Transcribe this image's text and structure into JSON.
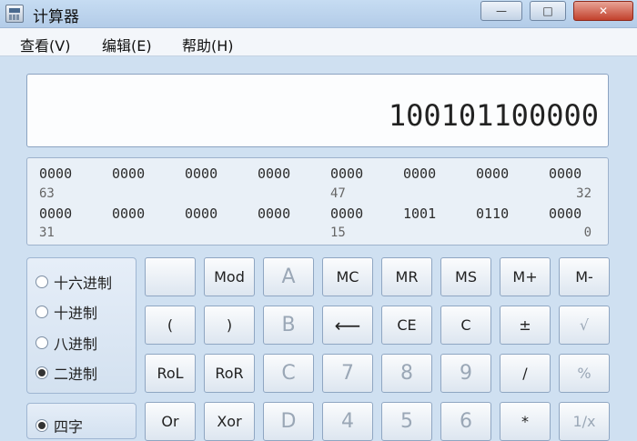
{
  "window": {
    "title": "计算器",
    "controls": {
      "minimize": "—",
      "maximize": "□",
      "close": "✕"
    }
  },
  "menu": [
    "查看(V)",
    "编辑(E)",
    "帮助(H)"
  ],
  "display": {
    "value": "100101100000"
  },
  "binary_view": {
    "row1": {
      "groups": [
        "0000",
        "0000",
        "0000",
        "0000",
        "0000",
        "0000",
        "0000",
        "0000"
      ],
      "indices": [
        "63",
        "47",
        "32"
      ]
    },
    "row2": {
      "groups": [
        "0000",
        "0000",
        "0000",
        "0000",
        "0000",
        "1001",
        "0110",
        "0000"
      ],
      "indices": [
        "31",
        "15",
        "0"
      ]
    }
  },
  "radix": {
    "options": [
      "十六进制",
      "十进制",
      "八进制",
      "二进制"
    ],
    "selected": "二进制"
  },
  "word_size": {
    "options": [
      "四字"
    ],
    "selected": "四字"
  },
  "keys": {
    "blank": "",
    "mod": "Mod",
    "A": "A",
    "mc": "MC",
    "mr": "MR",
    "ms": "MS",
    "mplus": "M+",
    "mminus": "M-",
    "lparen": "(",
    "rparen": ")",
    "B": "B",
    "back": "⟵",
    "ce": "CE",
    "c": "C",
    "pm": "±",
    "sqrt": "√",
    "rol": "RoL",
    "ror": "RoR",
    "C": "C",
    "k7": "7",
    "k8": "8",
    "k9": "9",
    "div": "/",
    "pct": "%",
    "or": "Or",
    "xor": "Xor",
    "D": "D",
    "k4": "4",
    "k5": "5",
    "k6": "6",
    "mul": "*",
    "inv": "1/x"
  }
}
